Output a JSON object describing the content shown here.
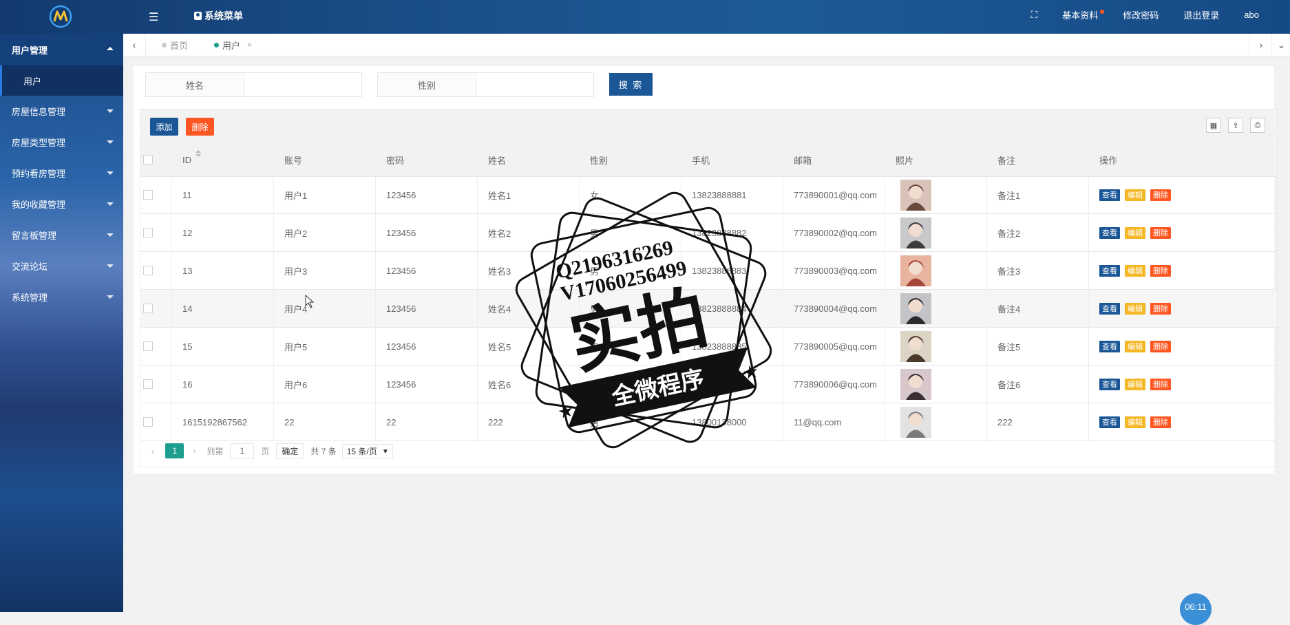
{
  "header": {
    "system_menu": "系统菜单",
    "fullscreen_icon": "expand-icon",
    "profile": "基本资料",
    "change_password": "修改密码",
    "logout": "退出登录",
    "username": "abo"
  },
  "sidebar": {
    "items": [
      {
        "label": "用户管理",
        "open": true,
        "children": [
          "用户"
        ]
      },
      {
        "label": "房屋信息管理"
      },
      {
        "label": "房屋类型管理"
      },
      {
        "label": "预约看房管理"
      },
      {
        "label": "我的收藏管理"
      },
      {
        "label": "留言板管理"
      },
      {
        "label": "交流论坛"
      },
      {
        "label": "系统管理"
      }
    ]
  },
  "tabs": {
    "home": "首页",
    "user": "用户",
    "close": "×"
  },
  "search": {
    "name_label": "姓名",
    "gender_label": "性别",
    "button": "搜 索"
  },
  "toolbar": {
    "add": "添加",
    "delete": "删除"
  },
  "table": {
    "columns": [
      "ID",
      "账号",
      "密码",
      "姓名",
      "性别",
      "手机",
      "邮箱",
      "照片",
      "备注",
      "操作"
    ],
    "actions": {
      "view": "查看",
      "edit": "编辑",
      "delete": "删除"
    },
    "rows": [
      {
        "id": "11",
        "account": "用户1",
        "password": "123456",
        "name": "姓名1",
        "gender": "女",
        "phone": "13823888881",
        "email": "773890001@qq.com",
        "note": "备注1"
      },
      {
        "id": "12",
        "account": "用户2",
        "password": "123456",
        "name": "姓名2",
        "gender": "男",
        "phone": "13823888882",
        "email": "773890002@qq.com",
        "note": "备注2"
      },
      {
        "id": "13",
        "account": "用户3",
        "password": "123456",
        "name": "姓名3",
        "gender": "男",
        "phone": "13823888883",
        "email": "773890003@qq.com",
        "note": "备注3"
      },
      {
        "id": "14",
        "account": "用户4",
        "password": "123456",
        "name": "姓名4",
        "gender": "男",
        "phone": "13823888884",
        "email": "773890004@qq.com",
        "note": "备注4"
      },
      {
        "id": "15",
        "account": "用户5",
        "password": "123456",
        "name": "姓名5",
        "gender": "男",
        "phone": "13823888885",
        "email": "773890005@qq.com",
        "note": "备注5"
      },
      {
        "id": "16",
        "account": "用户6",
        "password": "123456",
        "name": "姓名6",
        "gender": "男",
        "phone": "13823888886",
        "email": "773890006@qq.com",
        "note": "备注6"
      },
      {
        "id": "1615192867562",
        "account": "22",
        "password": "22",
        "name": "222",
        "gender": "男",
        "phone": "13800138000",
        "email": "11@qq.com",
        "note": "222"
      }
    ]
  },
  "pager": {
    "current": "1",
    "goto": "到第",
    "page_input": "1",
    "page_unit": "页",
    "confirm": "确定",
    "total": "共 7 条",
    "page_size": "15 条/页"
  },
  "watermark": {
    "qq": "Q2196316269",
    "vx": "V17060256499",
    "big": "实拍",
    "banner": "全微程序"
  },
  "clock": "06:11",
  "colors": {
    "primary": "#1b5797",
    "danger": "#ff5722",
    "warning": "#f5b724",
    "pager_active": "#1e9e8e"
  }
}
